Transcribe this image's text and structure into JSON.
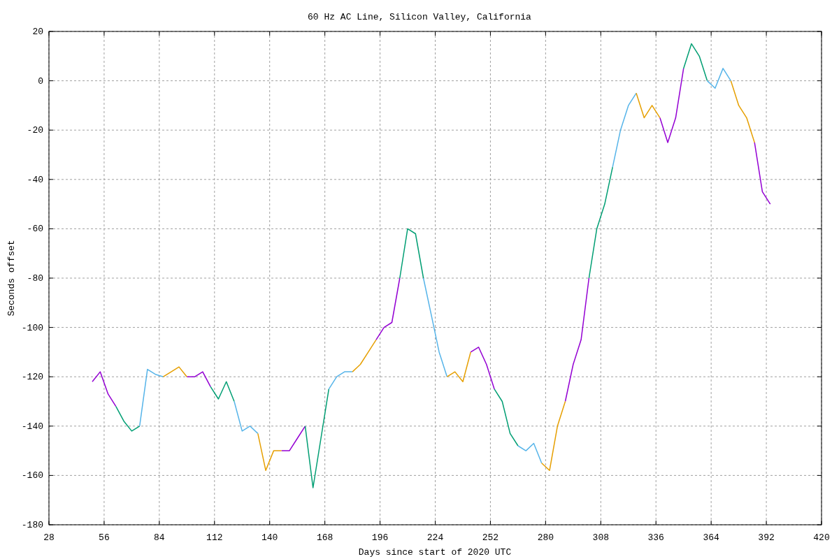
{
  "chart": {
    "chart_data": {
      "type": "line",
      "title": "60 Hz AC Line, Silicon Valley, California",
      "xlabel": "Days since start of 2020 UTC",
      "ylabel": "Seconds offset",
      "x": [
        50,
        54,
        58,
        62,
        66,
        70,
        74,
        78,
        82,
        86,
        90,
        94,
        98,
        102,
        106,
        110,
        114,
        118,
        122,
        126,
        130,
        134,
        138,
        142,
        146,
        150,
        154,
        158,
        162,
        166,
        170,
        174,
        178,
        182,
        186,
        190,
        194,
        198,
        202,
        206,
        210,
        214,
        218,
        222,
        226,
        230,
        234,
        238,
        242,
        246,
        250,
        254,
        258,
        262,
        266,
        270,
        274,
        278,
        282,
        286,
        290,
        294,
        298,
        302,
        306,
        310,
        314,
        318,
        322,
        326,
        330,
        334,
        338,
        342,
        346,
        350,
        354,
        358,
        362,
        366,
        370,
        374,
        378,
        382,
        386,
        390,
        394
      ],
      "series": [
        {
          "color": "#9400d3",
          "values": [
            -122,
            -118,
            -127,
            -132,
            null,
            null,
            null,
            null,
            null,
            null,
            null,
            null,
            -120,
            -120,
            -118,
            -124,
            null,
            null,
            null,
            null,
            null,
            null,
            null,
            null,
            -150,
            -150,
            -145,
            -140,
            null,
            null,
            null,
            null,
            null,
            null,
            null,
            null,
            -105,
            -100,
            -98,
            -80,
            null,
            null,
            null,
            null,
            null,
            null,
            null,
            null,
            -110,
            -108,
            -115,
            -125,
            null,
            null,
            null,
            null,
            null,
            null,
            null,
            null,
            -130,
            -115,
            -105,
            -80,
            null,
            null,
            null,
            null,
            null,
            null,
            null,
            null,
            -15,
            -25,
            -15,
            5,
            null,
            null,
            null,
            null,
            null,
            null,
            null,
            null,
            -25,
            -45,
            -50
          ]
        },
        {
          "color": "#009e73",
          "values": [
            null,
            null,
            null,
            -132,
            -138,
            -142,
            -140,
            null,
            null,
            null,
            null,
            null,
            null,
            null,
            null,
            -124,
            -129,
            -122,
            -130,
            null,
            null,
            null,
            null,
            null,
            null,
            null,
            null,
            -140,
            -165,
            -145,
            -125,
            null,
            null,
            null,
            null,
            null,
            null,
            null,
            null,
            -80,
            -60,
            -62,
            -80,
            null,
            null,
            null,
            null,
            null,
            null,
            null,
            null,
            -125,
            -130,
            -143,
            -148,
            null,
            null,
            null,
            null,
            null,
            null,
            null,
            null,
            -80,
            -60,
            -50,
            -35,
            null,
            null,
            null,
            null,
            null,
            null,
            null,
            null,
            5,
            15,
            10,
            0,
            null,
            null,
            null,
            null,
            null,
            null,
            null,
            null
          ]
        },
        {
          "color": "#56b4e9",
          "values": [
            null,
            null,
            null,
            null,
            null,
            null,
            -140,
            -117,
            -119,
            -120,
            null,
            null,
            null,
            null,
            null,
            null,
            null,
            null,
            -130,
            -142,
            -140,
            -143,
            null,
            null,
            null,
            null,
            null,
            null,
            null,
            null,
            -125,
            -120,
            -118,
            -118,
            null,
            null,
            null,
            null,
            null,
            null,
            null,
            null,
            -80,
            -95,
            -110,
            -120,
            null,
            null,
            null,
            null,
            null,
            null,
            null,
            null,
            -148,
            -150,
            -147,
            -155,
            null,
            null,
            null,
            null,
            null,
            null,
            null,
            null,
            -35,
            -20,
            -10,
            -5,
            null,
            null,
            null,
            null,
            null,
            null,
            null,
            null,
            0,
            -3,
            5,
            0,
            null,
            null,
            null,
            null,
            null
          ]
        },
        {
          "color": "#e69f00",
          "values": [
            null,
            null,
            null,
            null,
            null,
            null,
            null,
            null,
            null,
            -120,
            -118,
            -116,
            -120,
            null,
            null,
            null,
            null,
            null,
            null,
            null,
            null,
            -143,
            -158,
            -150,
            -150,
            null,
            null,
            null,
            null,
            null,
            null,
            null,
            null,
            -118,
            -115,
            -110,
            -105,
            null,
            null,
            null,
            null,
            null,
            null,
            null,
            null,
            -120,
            -118,
            -122,
            -110,
            null,
            null,
            null,
            null,
            null,
            null,
            null,
            null,
            -155,
            -158,
            -140,
            -130,
            null,
            null,
            null,
            null,
            null,
            null,
            null,
            null,
            -5,
            -15,
            -10,
            -15,
            null,
            null,
            null,
            null,
            null,
            null,
            null,
            null,
            0,
            -10,
            -15,
            -25,
            null,
            null
          ]
        }
      ],
      "grid": true,
      "xlim": [
        28,
        420
      ],
      "ylim": [
        -180,
        20
      ],
      "xticks": [
        28,
        56,
        84,
        112,
        140,
        168,
        196,
        224,
        252,
        280,
        308,
        336,
        364,
        392,
        420
      ],
      "yticks": [
        -180,
        -160,
        -140,
        -120,
        -100,
        -80,
        -60,
        -40,
        -20,
        0,
        20
      ]
    }
  }
}
